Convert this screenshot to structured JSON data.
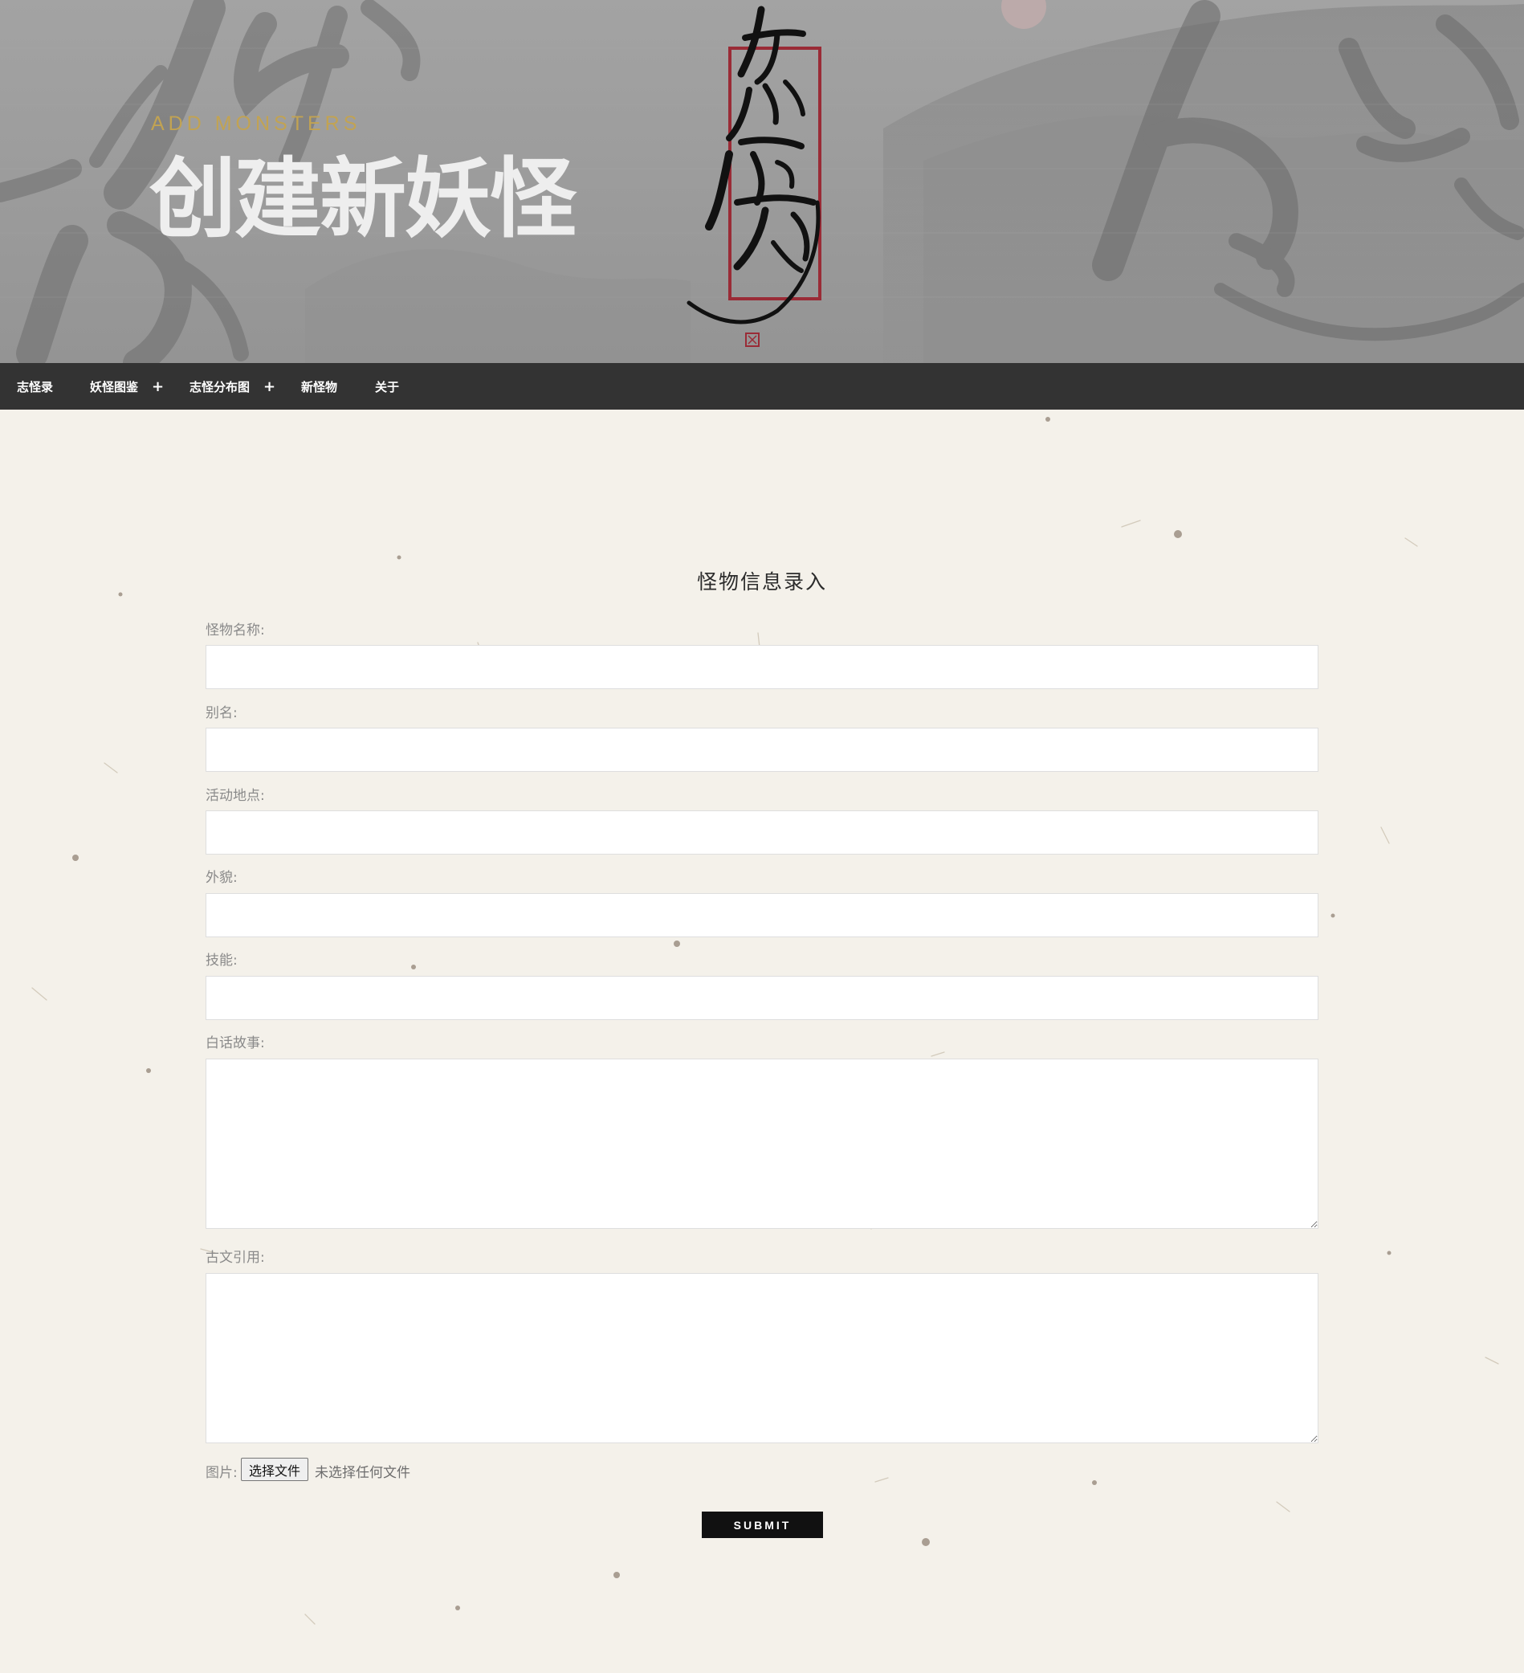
{
  "hero": {
    "subtitle": "ADD MONSTERS",
    "title": "创建新妖怪"
  },
  "nav": {
    "items": [
      {
        "label": "志怪录",
        "has_submenu": false
      },
      {
        "label": "妖怪图鉴",
        "has_submenu": true
      },
      {
        "label": "志怪分布图",
        "has_submenu": true
      },
      {
        "label": "新怪物",
        "has_submenu": false
      },
      {
        "label": "关于",
        "has_submenu": false
      }
    ],
    "submenu_icon": "+"
  },
  "form": {
    "title": "怪物信息录入",
    "fields": {
      "name": {
        "label": "怪物名称:",
        "value": ""
      },
      "alias": {
        "label": "别名:",
        "value": ""
      },
      "location": {
        "label": "活动地点:",
        "value": ""
      },
      "appearance": {
        "label": "外貌:",
        "value": ""
      },
      "skills": {
        "label": "技能:",
        "value": ""
      },
      "story": {
        "label": "白话故事:",
        "value": ""
      },
      "quote": {
        "label": "古文引用:",
        "value": ""
      }
    },
    "image": {
      "label": "图片:",
      "button_label": "选择文件",
      "status": "未选择任何文件"
    },
    "submit_label": "SUBMIT"
  },
  "colors": {
    "nav_background": "#333333",
    "accent_gold": "#c2a352",
    "submit_background": "#111111",
    "seal_red": "#9a2b36",
    "paper_background": "#f4f1ea"
  }
}
